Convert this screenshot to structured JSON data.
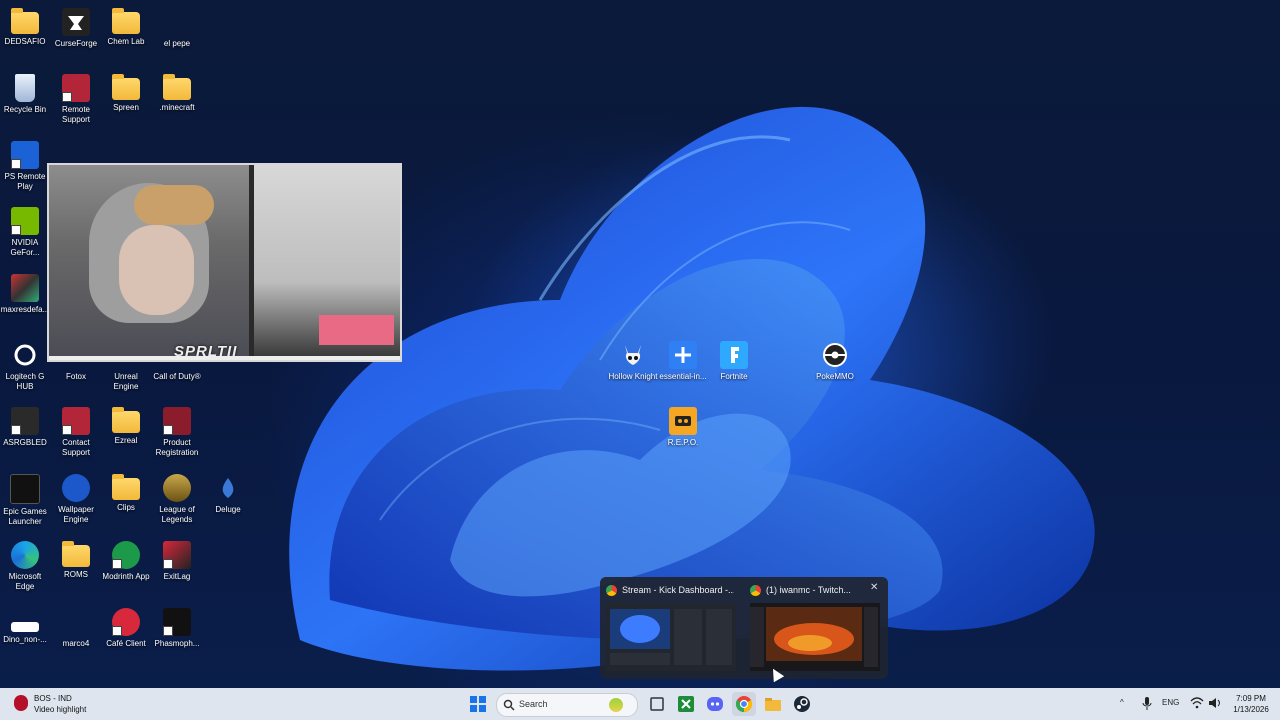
{
  "desktop_icons": [
    {
      "label": "DEDSAFIO",
      "icon": "folder-icon"
    },
    {
      "label": "CurseForge",
      "icon": "curseforge-icon"
    },
    {
      "label": "Chem Lab",
      "icon": "folder-icon"
    },
    {
      "label": "el pepe",
      "icon": "blank-file-icon"
    },
    {
      "label": "Recycle Bin",
      "icon": "recycle-bin-icon"
    },
    {
      "label": "Remote Support",
      "icon": "remote-support-icon"
    },
    {
      "label": "Spreen",
      "icon": "folder-icon"
    },
    {
      "label": ".minecraft",
      "icon": "folder-icon"
    },
    {
      "label": "PS Remote Play",
      "icon": "ps-remote-play-icon"
    },
    {
      "label": "NVIDIA GeFor...",
      "icon": "nvidia-icon"
    },
    {
      "label": "maxresdefa...",
      "icon": "image-file-icon"
    },
    {
      "label": "Logitech G HUB",
      "icon": "logitech-icon"
    },
    {
      "label": "Fotox",
      "icon": "folder-icon"
    },
    {
      "label": "Unreal Engine",
      "icon": "unreal-icon"
    },
    {
      "label": "Call of Duty®",
      "icon": "cod-icon"
    },
    {
      "label": "ASRGBLED",
      "icon": "asrock-icon"
    },
    {
      "label": "Contact Support",
      "icon": "contact-support-icon"
    },
    {
      "label": "Ezreal",
      "icon": "folder-icon"
    },
    {
      "label": "Product Registration",
      "icon": "product-registration-icon"
    },
    {
      "label": "Epic Games Launcher",
      "icon": "epic-games-icon"
    },
    {
      "label": "Wallpaper Engine",
      "icon": "wallpaper-engine-icon"
    },
    {
      "label": "Clips",
      "icon": "folder-icon"
    },
    {
      "label": "League of Legends",
      "icon": "league-icon"
    },
    {
      "label": "Deluge",
      "icon": "deluge-icon"
    },
    {
      "label": "Microsoft Edge",
      "icon": "edge-icon"
    },
    {
      "label": "ROMS",
      "icon": "folder-icon"
    },
    {
      "label": "Modrinth App",
      "icon": "modrinth-icon"
    },
    {
      "label": "ExitLag",
      "icon": "exitlag-icon"
    },
    {
      "label": "Dino_non-...",
      "icon": "dino-file-icon"
    },
    {
      "label": "marco4",
      "icon": "blank-file-icon"
    },
    {
      "label": "Café Client",
      "icon": "cafe-client-icon"
    },
    {
      "label": "Phasmoph...",
      "icon": "phasmophobia-icon"
    },
    {
      "label": "Hollow Knight",
      "icon": "hollow-knight-icon"
    },
    {
      "label": "essential-in...",
      "icon": "essential-icon"
    },
    {
      "label": "Fortnite",
      "icon": "fortnite-icon"
    },
    {
      "label": "PokeMMO",
      "icon": "pokemmo-icon"
    },
    {
      "label": "R.E.P.O.",
      "icon": "repo-icon"
    }
  ],
  "webcam": {
    "overlay_text": "SPRLTII"
  },
  "taskbar": {
    "widget": {
      "line1": "BOS - IND",
      "line2": "Video highlight"
    },
    "search_label": "Search",
    "tray": {
      "language": "ENG"
    },
    "clock": {
      "time": "7:09 PM",
      "date": "1/13/2026"
    },
    "apps": [
      "start-icon",
      "search-icon",
      "task-view-icon",
      "xbox-icon",
      "discord-icon",
      "chrome-icon",
      "file-explorer-icon",
      "steam-icon"
    ]
  },
  "preview": {
    "items": [
      {
        "title": "Stream - Kick Dashboard -..."
      },
      {
        "title": "(1) iwanmc - Twitch..."
      }
    ],
    "close_symbol": "✕"
  },
  "colors": {
    "taskbar_bg": "#dfe5ee",
    "desktop_bg": "#071537",
    "accent": "#1f6bff"
  }
}
